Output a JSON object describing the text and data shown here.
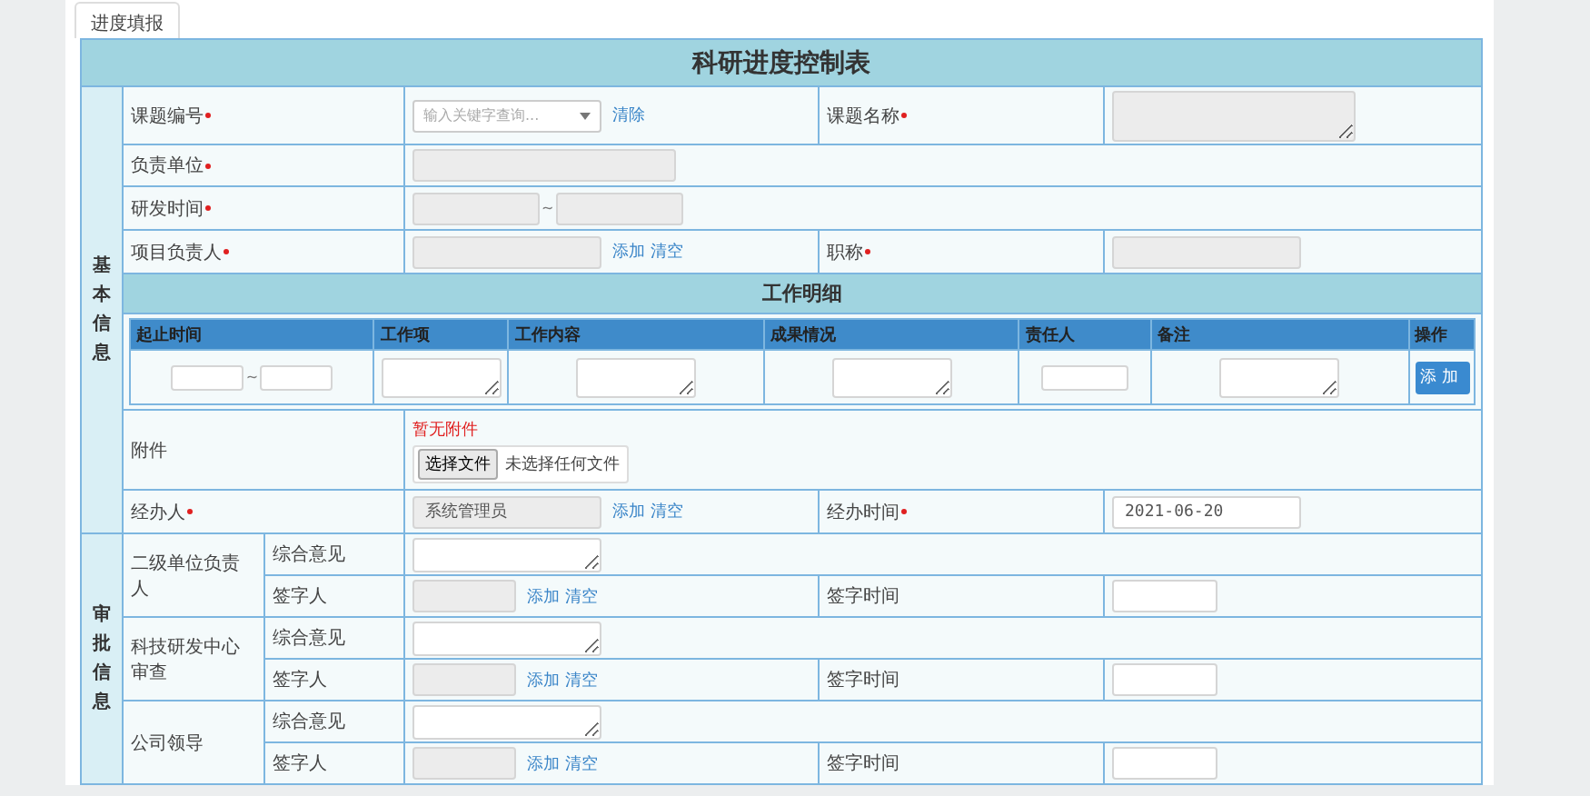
{
  "tab": {
    "label": "进度填报",
    "selected": true
  },
  "form_title": "科研进度控制表",
  "basic_info": {
    "section_label": "基本信息",
    "project_code": {
      "label": "课题编号",
      "required": true,
      "placeholder": "输入关键字查询...",
      "link": "清除"
    },
    "project_name": {
      "label": "课题名称",
      "required": true,
      "disabled": true
    },
    "unit": {
      "label": "负责单位",
      "required": true,
      "disabled": true
    },
    "dev_time": {
      "label": "研发时间",
      "required": true,
      "disabled": true,
      "separator": "~"
    },
    "leader": {
      "label": "项目负责人",
      "required": true,
      "disabled": true,
      "links": [
        "添加",
        "清空"
      ]
    },
    "job_title": {
      "label": "职称",
      "required": true,
      "disabled": true
    },
    "work_detail": {
      "title": "工作明细",
      "columns": [
        "起止时间",
        "工作项",
        "工作内容",
        "成果情况",
        "责任人",
        "备注",
        "操作"
      ],
      "separator": "~",
      "button": "添加"
    },
    "attachment": {
      "label": "附件",
      "note": "暂无附件",
      "file_button": "选择文件",
      "file_status": "未选择任何文件"
    },
    "handler": {
      "label": "经办人",
      "required": true,
      "disabled": true,
      "value": "系统管理员",
      "links": [
        "添加",
        "清空"
      ]
    },
    "handle_time": {
      "label": "经办时间",
      "required": true,
      "disabled": false,
      "value": "2021-06-20"
    }
  },
  "approval": {
    "section_label": "审批信息",
    "groups": [
      {
        "name": "二级单位负责人",
        "opinion_label": "综合意见",
        "signer_label": "签字人",
        "signer_disabled": true,
        "links": [
          "添加",
          "清空"
        ],
        "time_label": "签字时间"
      },
      {
        "name": "科技研发中心审查",
        "opinion_label": "综合意见",
        "signer_label": "签字人",
        "signer_disabled": true,
        "links": [
          "添加",
          "清空"
        ],
        "time_label": "签字时间"
      },
      {
        "name": "公司领导",
        "opinion_label": "综合意见",
        "signer_label": "签字人",
        "signer_disabled": true,
        "links": [
          "添加",
          "清空"
        ],
        "time_label": "签字时间"
      }
    ]
  }
}
